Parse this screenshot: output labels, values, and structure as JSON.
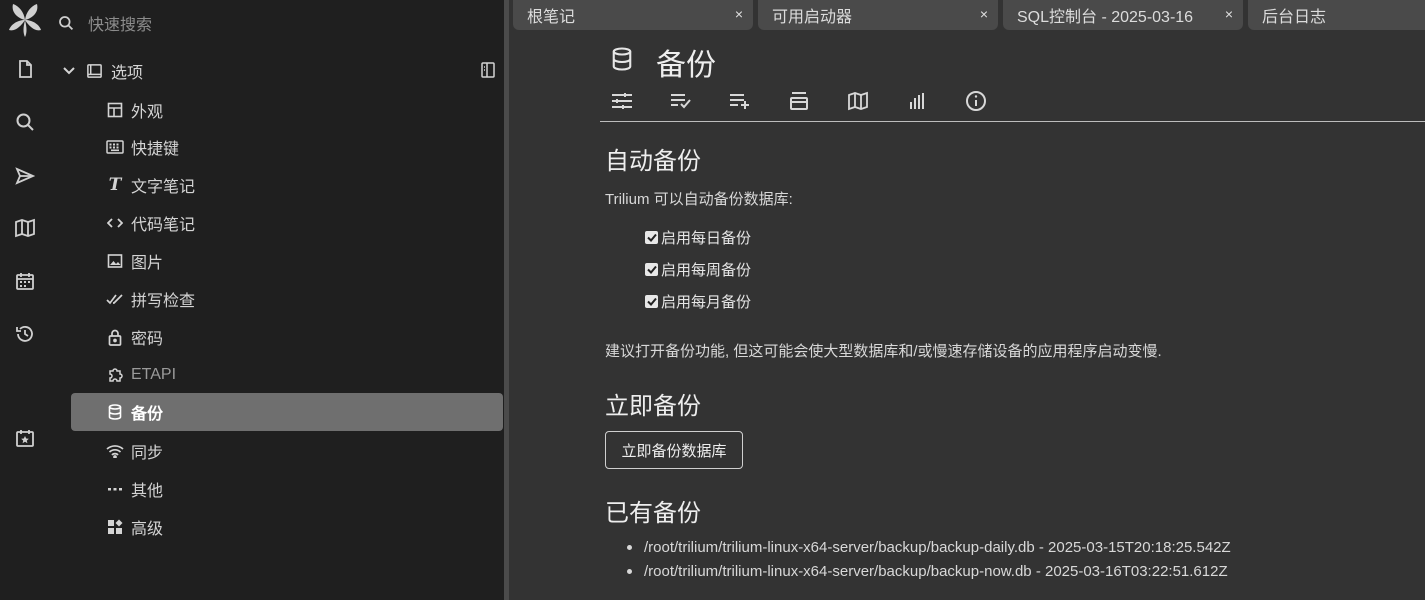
{
  "search": {
    "placeholder": "快速搜索"
  },
  "tree": {
    "root_label": "选项",
    "items": [
      {
        "label": "外观",
        "icon": "layout-icon"
      },
      {
        "label": "快捷键",
        "icon": "keyboard-icon"
      },
      {
        "label": "文字笔记",
        "icon": "text-icon"
      },
      {
        "label": "代码笔记",
        "icon": "code-icon"
      },
      {
        "label": "图片",
        "icon": "image-icon"
      },
      {
        "label": "拼写检查",
        "icon": "check-double-icon"
      },
      {
        "label": "密码",
        "icon": "lock-icon"
      },
      {
        "label": "ETAPI",
        "icon": "extension-icon"
      },
      {
        "label": "备份",
        "icon": "database-icon",
        "active": true
      },
      {
        "label": "同步",
        "icon": "wifi-icon"
      },
      {
        "label": "其他",
        "icon": "dots-icon"
      },
      {
        "label": "高级",
        "icon": "widgets-icon"
      }
    ]
  },
  "tabs": [
    {
      "label": "根笔记",
      "close": "×"
    },
    {
      "label": "可用启动器",
      "close": "×"
    },
    {
      "label": "SQL控制台 - 2025-03-16",
      "close": "×"
    },
    {
      "label": "后台日志"
    }
  ],
  "note": {
    "title": "备份",
    "subtabs": [
      "options-icon",
      "list-check-icon",
      "list-add-icon",
      "collapse-icon",
      "map-icon",
      "stats-icon",
      "info-icon"
    ]
  },
  "auto_backup": {
    "heading": "自动备份",
    "intro": "Trilium 可以自动备份数据库:",
    "options": [
      "启用每日备份",
      "启用每周备份",
      "启用每月备份"
    ],
    "note": "建议打开备份功能, 但这可能会使大型数据库和/或慢速存储设备的应用程序启动变慢."
  },
  "backup_now": {
    "heading": "立即备份",
    "button": "立即备份数据库"
  },
  "existing": {
    "heading": "已有备份",
    "items": [
      "/root/trilium/trilium-linux-x64-server/backup/backup-daily.db - 2025-03-15T20:18:25.542Z",
      "/root/trilium/trilium-linux-x64-server/backup/backup-now.db - 2025-03-16T03:22:51.612Z"
    ]
  },
  "colors": {
    "sidebar_bg": "#1f1f1f",
    "content_bg": "#333333",
    "active_item_bg": "#6f6f6f",
    "tab_bg": "#4a4a4a"
  }
}
